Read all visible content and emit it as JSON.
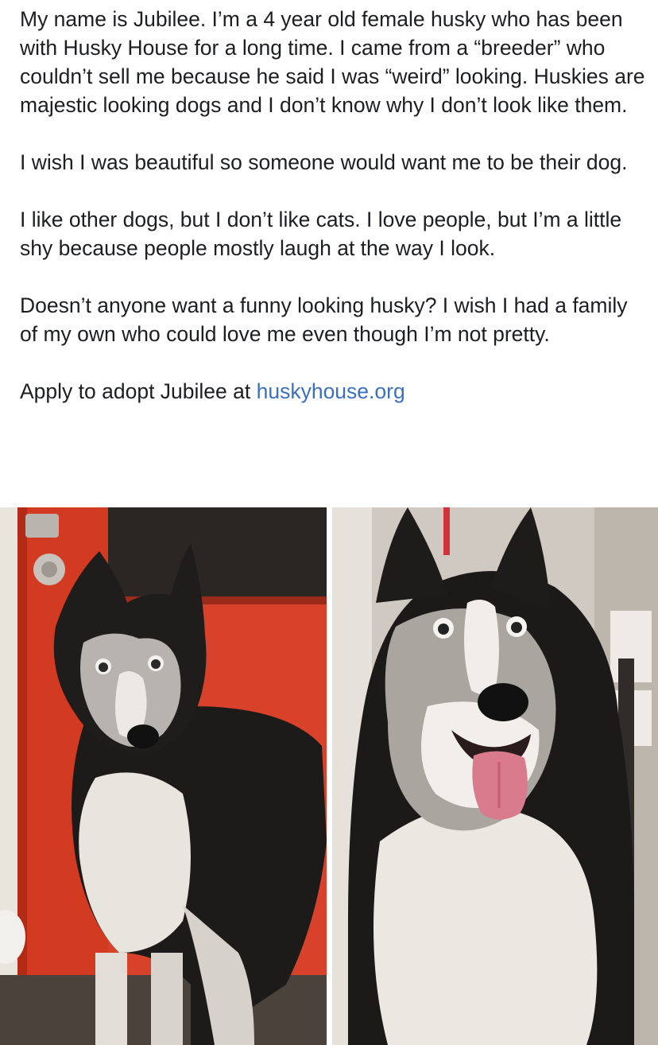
{
  "post": {
    "paragraphs": [
      "My name is Jubilee. I’m a 4 year old female husky who has been with Husky House for a long time. I came from a “breeder” who couldn’t sell me because he said I was “weird” looking. Huskies are majestic looking dogs and I don’t know why I don’t look like them.",
      "I wish I was beautiful so someone would want me to be their dog.",
      "I like other dogs, but I don’t like cats.  I love people, but I’m a little shy because people mostly laugh at the way I look.",
      "Doesn’t anyone want a funny looking husky? I wish I had a family of my own who could love me even though I’m not pretty."
    ],
    "apply_text": "Apply to adopt Jubilee at ",
    "link_text": "huskyhouse.org",
    "link_color": "#3b6fc2"
  },
  "photos": [
    {
      "subject": "husky-standing-by-red-door"
    },
    {
      "subject": "husky-smiling-tongue-out"
    }
  ]
}
